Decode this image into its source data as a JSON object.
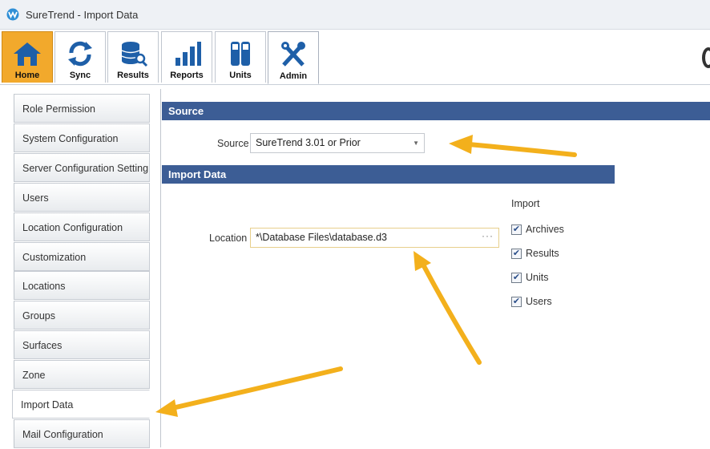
{
  "window": {
    "title": "SureTrend - Import Data"
  },
  "ribbon": {
    "tabs": [
      {
        "label": "Home",
        "icon": "home-icon"
      },
      {
        "label": "Sync",
        "icon": "sync-icon"
      },
      {
        "label": "Results",
        "icon": "results-icon"
      },
      {
        "label": "Reports",
        "icon": "reports-icon"
      },
      {
        "label": "Units",
        "icon": "units-icon"
      },
      {
        "label": "Admin",
        "icon": "admin-icon"
      }
    ],
    "active_tab": "Admin"
  },
  "sidebar": {
    "items": [
      {
        "label": "Role Permission"
      },
      {
        "label": "System Configuration"
      },
      {
        "label": "Server Configuration Setting"
      },
      {
        "label": "Users"
      },
      {
        "label": "Location Configuration"
      },
      {
        "label": "Customization"
      },
      {
        "label": "Locations"
      },
      {
        "label": "Groups"
      },
      {
        "label": "Surfaces"
      },
      {
        "label": "Zone"
      },
      {
        "label": "Import Data"
      },
      {
        "label": "Mail Configuration"
      }
    ],
    "selected": "Import Data"
  },
  "source_section": {
    "header": "Source",
    "source_label": "Source",
    "source_value": "SureTrend 3.01 or Prior"
  },
  "import_section": {
    "header": "Import Data",
    "location_label": "Location",
    "location_value": "*\\Database Files\\database.d3",
    "browse_label": "···",
    "import_label": "Import",
    "options": [
      {
        "label": "Archives",
        "checked": true
      },
      {
        "label": "Results",
        "checked": true
      },
      {
        "label": "Units",
        "checked": true
      },
      {
        "label": "Users",
        "checked": true
      }
    ]
  },
  "colors": {
    "section_header": "#3c5d95",
    "home_tab": "#f2a92c",
    "annotation_arrow": "#f3b01c"
  }
}
